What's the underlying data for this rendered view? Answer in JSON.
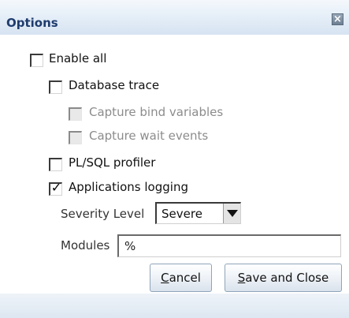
{
  "dialog": {
    "title": "Options",
    "close_icon": "close-icon"
  },
  "options": {
    "enable_all": {
      "label": "Enable all",
      "checked": false,
      "enabled": true
    },
    "database_trace": {
      "label": "Database trace",
      "checked": false,
      "enabled": true
    },
    "capture_bind_variables": {
      "label": "Capture bind variables",
      "checked": false,
      "enabled": false
    },
    "capture_wait_events": {
      "label": "Capture wait events",
      "checked": false,
      "enabled": false
    },
    "plsql_profiler": {
      "label": "PL/SQL profiler",
      "checked": false,
      "enabled": true
    },
    "applications_logging": {
      "label": "Applications logging",
      "checked": true,
      "enabled": true
    }
  },
  "severity": {
    "label": "Severity Level",
    "selected": "Severe",
    "dropdown_icon": "chevron-down-icon"
  },
  "modules": {
    "label": "Modules",
    "value": "%"
  },
  "buttons": {
    "cancel": {
      "mnemonic": "C",
      "rest": "ancel"
    },
    "save_and_close": {
      "mnemonic": "S",
      "rest": "ave and Close"
    }
  }
}
